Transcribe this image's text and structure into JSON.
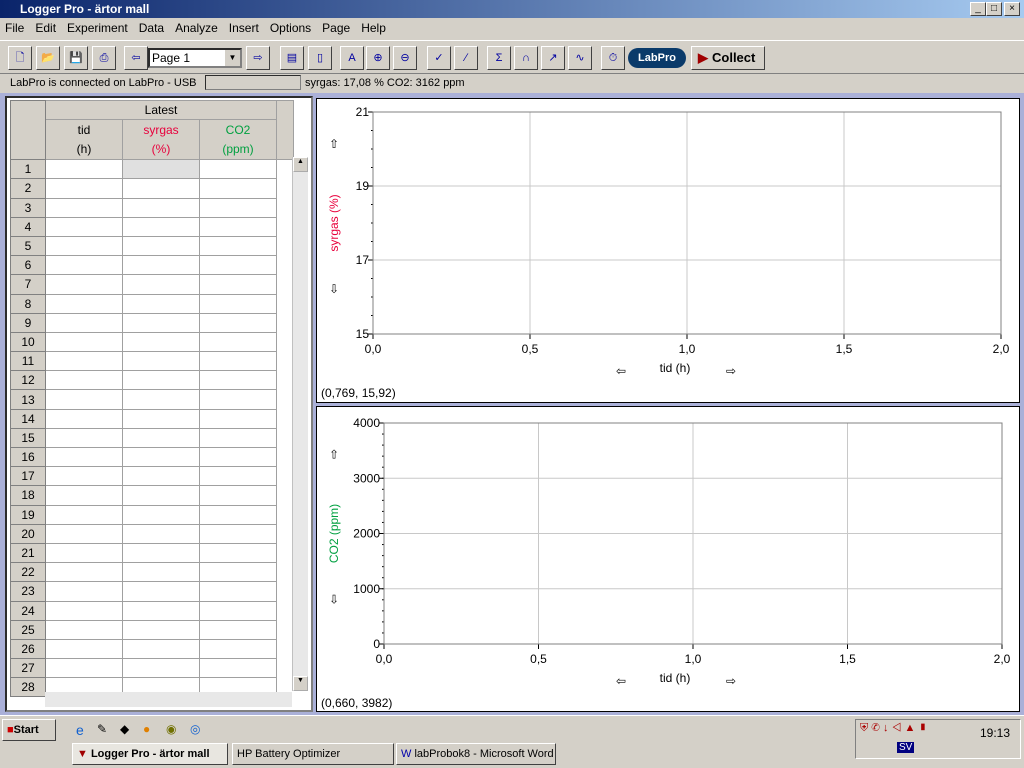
{
  "window": {
    "title": "Logger Pro - ärtor mall",
    "min": "_",
    "max": "□",
    "close": "×"
  },
  "menu": [
    "File",
    "Edit",
    "Experiment",
    "Data",
    "Analyze",
    "Insert",
    "Options",
    "Page",
    "Help"
  ],
  "toolbar": {
    "page_select": "Page 1",
    "labpro_button": "LabPro",
    "collect_button": "Collect",
    "icons": [
      "new-file-icon",
      "open-folder-icon",
      "save-icon",
      "print-icon",
      "prev-page-icon",
      "next-page-icon",
      "data-browser-icon",
      "interface-icon",
      "autoscale-icon",
      "zoom-in-icon",
      "zoom-out-icon",
      "examine-icon",
      "tangent-icon",
      "statistics-icon",
      "integral-icon",
      "linear-fit-icon",
      "curve-fit-icon",
      "timing-icon"
    ]
  },
  "status": {
    "connection": "LabPro is connected on LabPro - USB",
    "readout": "syrgas: 17,08 %  CO2: 3162 ppm"
  },
  "table": {
    "group_header": "Latest",
    "columns": [
      {
        "name": "tid",
        "unit": "(h)",
        "color": "#000000"
      },
      {
        "name": "syrgas",
        "unit": "(%)",
        "color": "#e8003c"
      },
      {
        "name": "CO2",
        "unit": "(ppm)",
        "color": "#00a040"
      }
    ],
    "row_count": 28
  },
  "chart_data": [
    {
      "type": "line",
      "ylabel": "syrgas (%)",
      "ylabel_color": "#e8003c",
      "xlabel": "tid (h)",
      "xlim": [
        0,
        2.0
      ],
      "ylim": [
        15,
        21
      ],
      "xticks": [
        "0,0",
        "0,5",
        "1,0",
        "1,5",
        "2,0"
      ],
      "yticks": [
        "15",
        "17",
        "19",
        "21"
      ],
      "grid": true,
      "series": [],
      "coordinate_readout": "(0,769, 15,92)"
    },
    {
      "type": "line",
      "ylabel": "CO2 (ppm)",
      "ylabel_color": "#00a040",
      "xlabel": "tid (h)",
      "xlim": [
        0,
        2.0
      ],
      "ylim": [
        0,
        4000
      ],
      "xticks": [
        "0,0",
        "0,5",
        "1,0",
        "1,5",
        "2,0"
      ],
      "yticks": [
        "0",
        "1000",
        "2000",
        "3000",
        "4000"
      ],
      "grid": true,
      "series": [],
      "coordinate_readout": "(0,660, 3982)"
    }
  ],
  "taskbar": {
    "start": "Start",
    "tasks": [
      "Logger Pro - ärtor mall",
      "HP Battery Optimizer",
      "labProbok8 - Microsoft Word"
    ],
    "clock": "19:13",
    "lang": "SV"
  }
}
